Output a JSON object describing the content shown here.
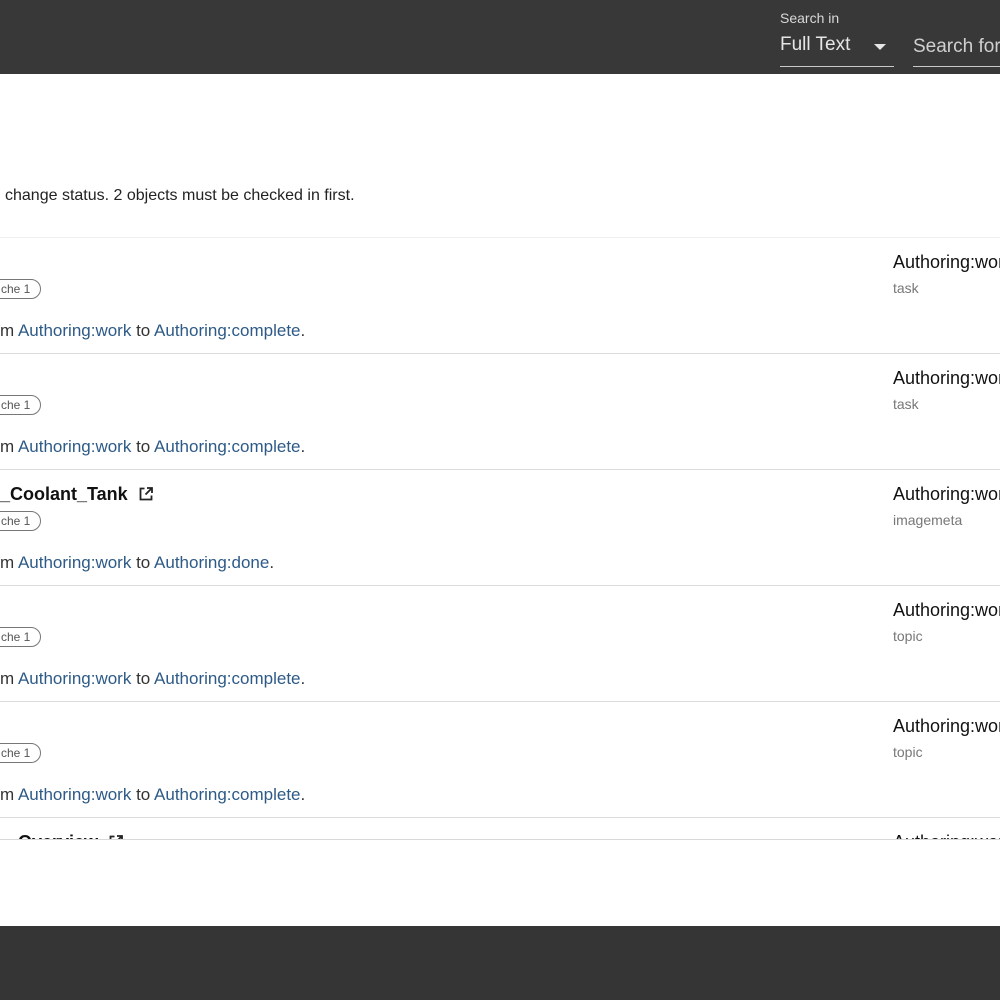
{
  "header": {
    "search_in_label": "Search in",
    "scope_value": "Full Text",
    "search_placeholder": "Search for"
  },
  "dialog": {
    "message": "change status. 2 objects must be checked in first."
  },
  "rows": [
    {
      "title": "",
      "chip": "che 1",
      "from_prefix": "m ",
      "from_state": "Authoring:work",
      "connector": " to ",
      "to_state": "Authoring:complete",
      "end": ".",
      "workflow_state": "Authoring:work",
      "object_type": "task"
    },
    {
      "title": "",
      "chip": "che 1",
      "from_prefix": "m ",
      "from_state": "Authoring:work",
      "connector": " to ",
      "to_state": "Authoring:complete",
      "end": ".",
      "workflow_state": "Authoring:work",
      "object_type": "task"
    },
    {
      "title": "_Coolant_Tank",
      "chip": "che 1",
      "from_prefix": "m ",
      "from_state": "Authoring:work",
      "connector": " to ",
      "to_state": "Authoring:done",
      "end": ".",
      "workflow_state": "Authoring:work",
      "object_type": "imagemeta"
    },
    {
      "title": "",
      "chip": "che 1",
      "from_prefix": "m ",
      "from_state": "Authoring:work",
      "connector": " to ",
      "to_state": "Authoring:complete",
      "end": ".",
      "workflow_state": "Authoring:work",
      "object_type": "topic"
    },
    {
      "title": "",
      "chip": "che 1",
      "from_prefix": "m ",
      "from_state": "Authoring:work",
      "connector": " to ",
      "to_state": "Authoring:complete",
      "end": ".",
      "workflow_state": "Authoring:work",
      "object_type": "topic"
    },
    {
      "title": "_Overview",
      "chip": "",
      "from_prefix": "",
      "from_state": "",
      "connector": "",
      "to_state": "",
      "end": "",
      "workflow_state": "Authoring:work",
      "object_type": ""
    }
  ],
  "colors": {
    "link_state": "#2d5a87",
    "chrome_dark": "#383838"
  },
  "icons": {
    "external_link": "external-link-icon",
    "dropdown": "caret-down-icon"
  }
}
